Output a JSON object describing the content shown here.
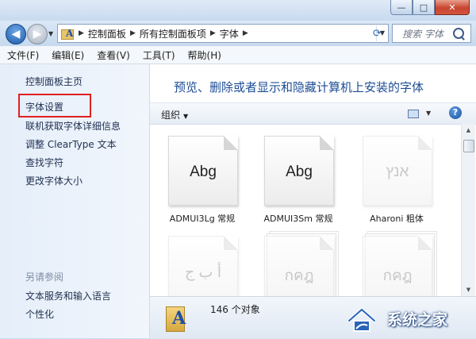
{
  "window": {
    "min": "—",
    "max": "□",
    "close": "✕"
  },
  "address": {
    "crumbs": [
      "控制面板",
      "所有控制面板项",
      "字体"
    ],
    "search_placeholder": "搜索 字体"
  },
  "menu": [
    "文件(F)",
    "编辑(E)",
    "查看(V)",
    "工具(T)",
    "帮助(H)"
  ],
  "nav_pane": {
    "tasks": [
      "控制面板主页",
      "字体设置",
      "联机获取字体详细信息",
      "调整 ClearType 文本",
      "查找字符",
      "更改字体大小"
    ],
    "see_also_title": "另请参阅",
    "see_also": [
      "文本服务和输入语言",
      "个性化"
    ]
  },
  "content": {
    "heading": "预览、删除或者显示和隐藏计算机上安装的字体",
    "toolbar": {
      "organize": "组织",
      "help": "?"
    },
    "fonts": [
      {
        "sample": "Abg",
        "label": "ADMUI3Lg 常规"
      },
      {
        "sample": "Abg",
        "label": "ADMUI3Sm 常规"
      },
      {
        "sample": "אנץ",
        "label": "Aharoni 粗体"
      },
      {
        "sample": "أ ب ج",
        "label": ""
      },
      {
        "sample": "กคฎ",
        "label": ""
      },
      {
        "sample": "กคฎ",
        "label": ""
      }
    ]
  },
  "status": {
    "count": "146 个对象"
  },
  "watermark": {
    "text": "系统之家"
  }
}
